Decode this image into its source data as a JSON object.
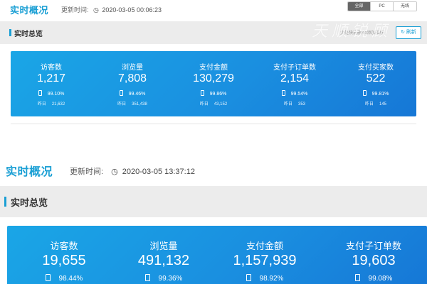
{
  "top": {
    "title": "实时概况",
    "update_label": "更新时间:",
    "update_time": "2020-03-05 00:06:23",
    "segments": [
      {
        "label": "全部",
        "active": true
      },
      {
        "label": "PC",
        "active": false
      },
      {
        "label": "无线",
        "active": false
      }
    ],
    "section_title": "实时总览",
    "hint": "此处快速删除/添加指标",
    "refresh_label": "刷新",
    "watermark": "天顺锐顾",
    "metrics": [
      {
        "label": "访客数",
        "value": "1,217",
        "pct": "99.10%",
        "yesterday_label": "昨日",
        "yesterday": "21,632"
      },
      {
        "label": "浏览量",
        "value": "7,808",
        "pct": "99.46%",
        "yesterday_label": "昨日",
        "yesterday": "351,438"
      },
      {
        "label": "支付金额",
        "value": "130,279",
        "pct": "99.86%",
        "yesterday_label": "昨日",
        "yesterday": "43,152"
      },
      {
        "label": "支付子订单数",
        "value": "2,154",
        "pct": "99.54%",
        "yesterday_label": "昨日",
        "yesterday": "353"
      },
      {
        "label": "支付买家数",
        "value": "522",
        "pct": "99.81%",
        "yesterday_label": "昨日",
        "yesterday": "145"
      }
    ]
  },
  "bottom": {
    "title": "实时概况",
    "update_label": "更新时间:",
    "update_time": "2020-03-05 13:37:12",
    "section_title": "实时总览",
    "metrics": [
      {
        "label": "访客数",
        "value": "19,655",
        "pct": "98.44%"
      },
      {
        "label": "浏览量",
        "value": "491,132",
        "pct": "99.36%"
      },
      {
        "label": "支付金额",
        "value": "1,157,939",
        "pct": "98.92%"
      },
      {
        "label": "支付子订单数",
        "value": "19,603",
        "pct": "99.08%"
      }
    ]
  },
  "icons": {
    "clock": "clock-icon",
    "phone": "mobile-phone-icon"
  },
  "colors": {
    "accent": "#1a9fd4",
    "card_start": "#1aa6e6",
    "card_end": "#1677d6",
    "band": "#ececec"
  }
}
